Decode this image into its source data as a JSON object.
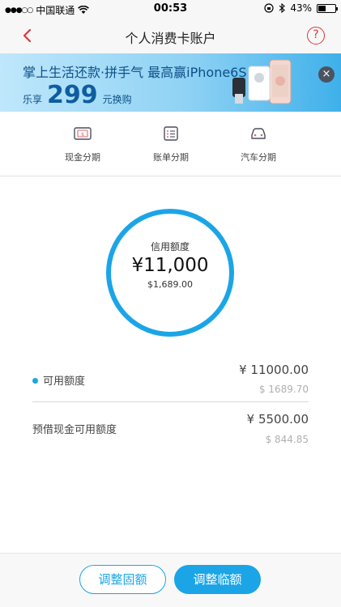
{
  "status_bar": {
    "signal": "●●●○○",
    "carrier": "中国联通",
    "time": "00:53",
    "battery": "43%",
    "battery_level": 0.43
  },
  "nav": {
    "title": "个人消费卡账户",
    "help": "?"
  },
  "banner": {
    "headline": "掌上生活还款·拼手气 最高赢iPhone6S",
    "prefix": "乐享",
    "number": "299",
    "suffix": "元换购",
    "close": "×"
  },
  "quick_menu": [
    {
      "label": "现金分期"
    },
    {
      "label": "账单分期"
    },
    {
      "label": "汽车分期"
    }
  ],
  "credit": {
    "label": "信用额度",
    "amount": "¥11,000",
    "usd": "$1,689.00"
  },
  "details": [
    {
      "label": "可用额度",
      "cny": "¥ 11000.00",
      "usd": "$ 1689.70"
    },
    {
      "label": "预借现金可用额度",
      "cny": "¥ 5500.00",
      "usd": "$ 844.85"
    }
  ],
  "actions": {
    "fixed": "调整固额",
    "temp": "调整临额"
  },
  "colors": {
    "accent": "#1ba5e7",
    "brand_red": "#d9383c"
  }
}
